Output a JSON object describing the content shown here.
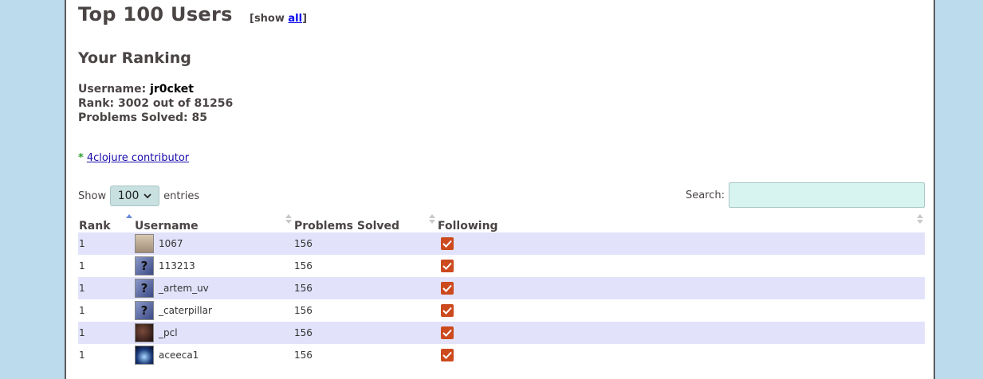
{
  "header": {
    "title": "Top 100 Users",
    "show_prefix": "[show ",
    "show_link": "all",
    "show_suffix": "]"
  },
  "ranking": {
    "heading": "Your Ranking",
    "username_label": "Username: ",
    "username_value": "jr0cket",
    "rank_text": "Rank: 3002 out of 81256",
    "solved_text": "Problems Solved: 85"
  },
  "legend": {
    "marker": "*",
    "link": "4clojure contributor"
  },
  "controls": {
    "show_label": "Show",
    "entries_value": "100",
    "entries_label": "entries",
    "search_label": "Search:",
    "search_value": ""
  },
  "table": {
    "columns": [
      "Rank",
      "Username",
      "Problems Solved",
      "Following"
    ],
    "rows": [
      {
        "rank": "1",
        "username": "1067",
        "avatar": "photo-face",
        "solved": "156",
        "following": true
      },
      {
        "rank": "1",
        "username": "113213",
        "avatar": "question-mark",
        "solved": "156",
        "following": true
      },
      {
        "rank": "1",
        "username": "_artem_uv",
        "avatar": "question-mark",
        "solved": "156",
        "following": true
      },
      {
        "rank": "1",
        "username": "_caterpillar",
        "avatar": "question-mark",
        "solved": "156",
        "following": true
      },
      {
        "rank": "1",
        "username": "_pcl",
        "avatar": "photo-dark",
        "solved": "156",
        "following": true
      },
      {
        "rank": "1",
        "username": "aceeca1",
        "avatar": "photo-blue",
        "solved": "156",
        "following": true
      }
    ]
  },
  "colors": {
    "background": "#bcdcee",
    "row_highlight": "#e2e2fb",
    "checkbox": "#cc4a1e",
    "link": "#0000ee",
    "contributor_star": "#2e9e2e"
  }
}
